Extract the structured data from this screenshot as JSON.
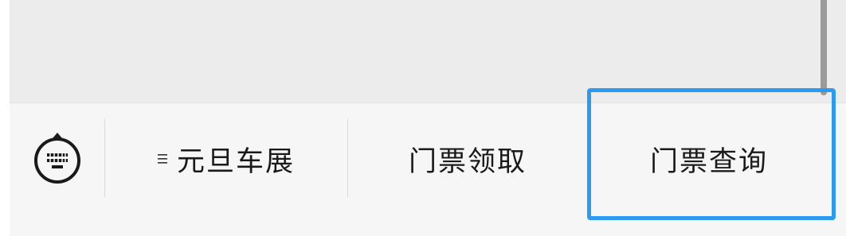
{
  "menu": {
    "keyboard_icon": "keyboard-icon",
    "items": [
      {
        "label": "元旦车展",
        "has_submenu": true,
        "submenu_icon": "menu-lines-icon"
      },
      {
        "label": "门票领取",
        "has_submenu": false
      },
      {
        "label": "门票查询",
        "has_submenu": false
      }
    ]
  },
  "colors": {
    "content_background": "#ececec",
    "menu_background": "#f6f6f6",
    "highlight_border": "#2b9af3",
    "text": "#1a1a1a"
  }
}
